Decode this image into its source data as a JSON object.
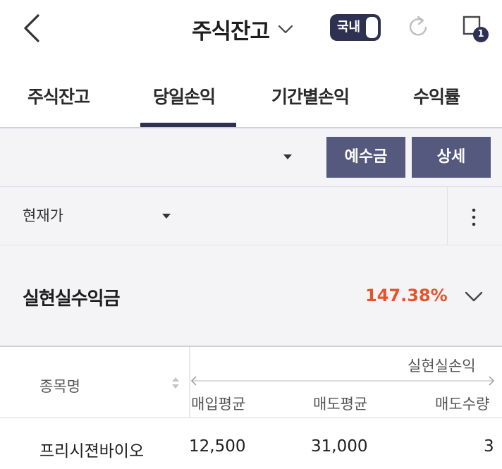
{
  "header": {
    "title": "주식잔고",
    "market_toggle_label": "국내",
    "notification_count": "1"
  },
  "tabs": [
    {
      "label": "주식잔고",
      "active": false
    },
    {
      "label": "당일손익",
      "active": true
    },
    {
      "label": "기간별손익",
      "active": false
    },
    {
      "label": "수익률",
      "active": false
    }
  ],
  "filter": {
    "account_select_value": "",
    "deposit_button": "예수금",
    "detail_button": "상세"
  },
  "sort": {
    "selected": "현재가"
  },
  "summary": {
    "label": "실현실수익금",
    "rate": "147.38%"
  },
  "table": {
    "name_header": "종목명",
    "group_header": "실현실손익",
    "columns": [
      "매입평균",
      "매도평균",
      "매도수량"
    ],
    "rows": [
      {
        "name": "프리시젼바이오",
        "cells": [
          "12,500",
          "31,000",
          "3"
        ]
      }
    ]
  },
  "colors": {
    "accent": "#2e3152",
    "button": "#55597e",
    "profit": "#e4552a"
  }
}
